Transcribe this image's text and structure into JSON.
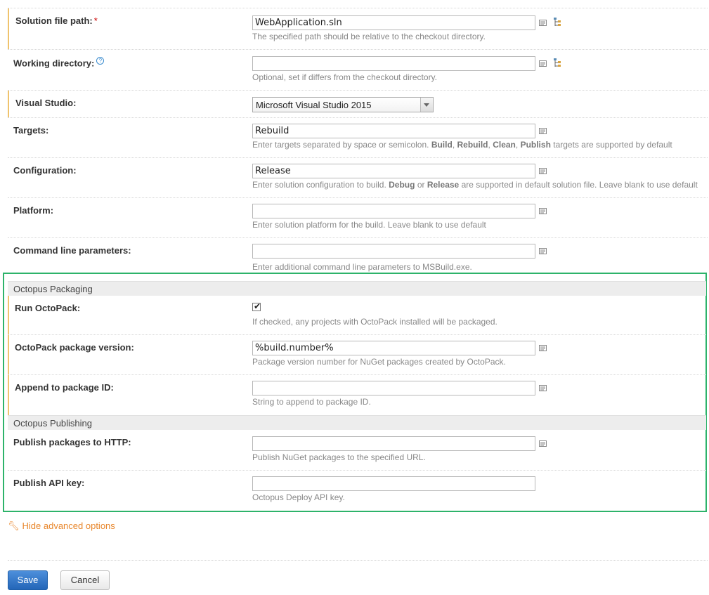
{
  "fields": {
    "solution_path": {
      "label": "Solution file path:",
      "required_mark": "*",
      "value": "WebApplication.sln",
      "hint": "The specified path should be relative to the checkout directory."
    },
    "working_dir": {
      "label": "Working directory:",
      "help_mark": "?",
      "value": "",
      "hint": "Optional, set if differs from the checkout directory."
    },
    "visual_studio": {
      "label": "Visual Studio:",
      "selected": "Microsoft Visual Studio 2015"
    },
    "targets": {
      "label": "Targets:",
      "value": "Rebuild",
      "hint_pre": "Enter targets separated by space or semicolon.",
      "hint_b1": "Build",
      "hint_sep1": ",",
      "hint_b2": "Rebuild",
      "hint_sep2": ",",
      "hint_b3": "Clean",
      "hint_sep3": ",",
      "hint_b4": "Publish",
      "hint_post": "targets are supported by default"
    },
    "configuration": {
      "label": "Configuration:",
      "value": "Release",
      "hint_pre": "Enter solution configuration to build.",
      "hint_b1": "Debug",
      "hint_mid": "or",
      "hint_b2": "Release",
      "hint_post": "are supported in default solution file. Leave blank to use default"
    },
    "platform": {
      "label": "Platform:",
      "value": "",
      "hint": "Enter solution platform for the build. Leave blank to use default"
    },
    "cmd_params": {
      "label": "Command line parameters:",
      "value": "",
      "hint": "Enter additional command line parameters to MSBuild.exe."
    }
  },
  "octopus_packaging": {
    "title": "Octopus Packaging",
    "run_octopack": {
      "label": "Run OctoPack:",
      "checked": true,
      "hint": "If checked, any projects with OctoPack installed will be packaged."
    },
    "package_version": {
      "label": "OctoPack package version:",
      "value": "%build.number%",
      "hint": "Package version number for NuGet packages created by OctoPack."
    },
    "append_id": {
      "label": "Append to package ID:",
      "value": "",
      "hint": "String to append to package ID."
    }
  },
  "octopus_publishing": {
    "title": "Octopus Publishing",
    "publish_http": {
      "label": "Publish packages to HTTP:",
      "value": "",
      "hint": "Publish NuGet packages to the specified URL."
    },
    "api_key": {
      "label": "Publish API key:",
      "value": "",
      "hint": "Octopus Deploy API key."
    }
  },
  "advanced_link": "Hide advanced options",
  "buttons": {
    "save": "Save",
    "cancel": "Cancel"
  },
  "colors": {
    "accent_orange": "#e8862b",
    "save_blue": "#2466b8",
    "highlight_green": "#2db36a",
    "required_yellow": "#f0c36d"
  },
  "icons": {
    "template": "template-icon",
    "tree": "tree-picker-icon",
    "wrench": "wrench-icon",
    "help": "help-icon"
  }
}
